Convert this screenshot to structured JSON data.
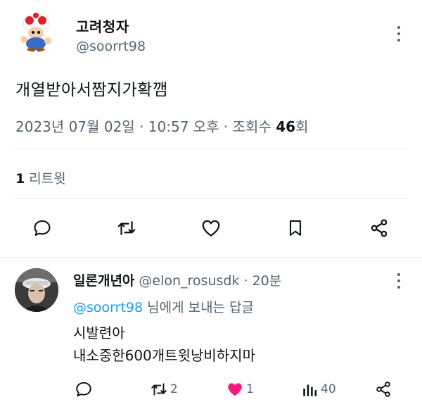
{
  "tweet": {
    "author_name": "고려청자",
    "author_handle": "@soorrt98",
    "text": "개열받아서짬지가확깸",
    "meta_prefix": "2023년 07월 02일 · 10:57 오후 · 조회수 ",
    "views": "46",
    "views_suffix": "회",
    "retweet_count": "1",
    "retweet_label": "리트윗"
  },
  "actions": {
    "icons": [
      "reply-icon",
      "retweet-icon",
      "like-icon",
      "bookmark-icon",
      "share-icon"
    ]
  },
  "reply": {
    "author_name": "일론개년아",
    "author_handle_time": "@elon_rosusdk · 20분",
    "reply_mention": "@soorrt98",
    "reply_to_suffix": " 님에게 보내는 답글",
    "text_line1": "시발련아",
    "text_line2": "내소중한600개트윗낭비하지마",
    "retweets": "2",
    "likes": "1",
    "views": "40"
  },
  "colors": {
    "accent": "#1d9bf0",
    "like": "#f91880",
    "secondary_text": "#536471"
  }
}
